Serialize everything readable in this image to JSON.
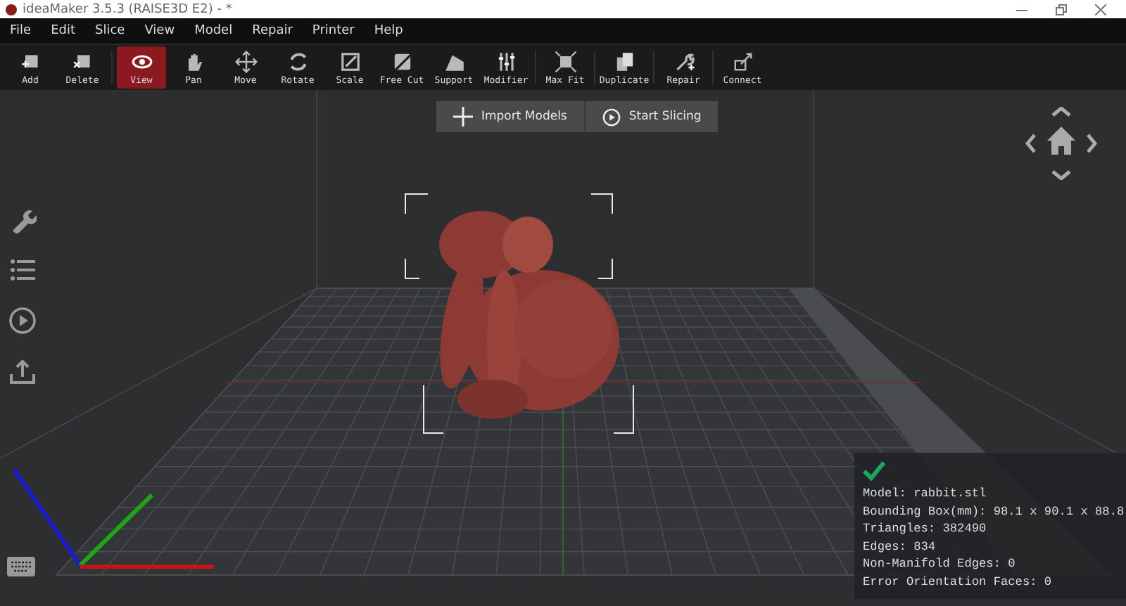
{
  "window": {
    "title": "ideaMaker 3.5.3 (RAISE3D E2) - *"
  },
  "menu": [
    "File",
    "Edit",
    "Slice",
    "View",
    "Model",
    "Repair",
    "Printer",
    "Help"
  ],
  "toolbar": [
    {
      "label": "Add",
      "selected": false
    },
    {
      "label": "Delete",
      "selected": false
    },
    {
      "label": "View",
      "selected": true
    },
    {
      "label": "Pan",
      "selected": false
    },
    {
      "label": "Move",
      "selected": false
    },
    {
      "label": "Rotate",
      "selected": false
    },
    {
      "label": "Scale",
      "selected": false
    },
    {
      "label": "Free Cut",
      "selected": false
    },
    {
      "label": "Support",
      "selected": false
    },
    {
      "label": "Modifier",
      "selected": false
    },
    {
      "label": "Max Fit",
      "selected": false
    },
    {
      "label": "Duplicate",
      "selected": false
    },
    {
      "label": "Repair",
      "selected": false
    },
    {
      "label": "Connect",
      "selected": false
    }
  ],
  "actions": [
    "Import Models",
    "Start Slicing"
  ],
  "model_info": {
    "lines": [
      "Model: rabbit.stl",
      "Bounding Box(mm): 98.1 x 90.1 x 88.8",
      "Triangles: 382490",
      "Edges: 834",
      "Non-Manifold Edges: 0",
      "Error Orientation Faces: 0"
    ]
  }
}
